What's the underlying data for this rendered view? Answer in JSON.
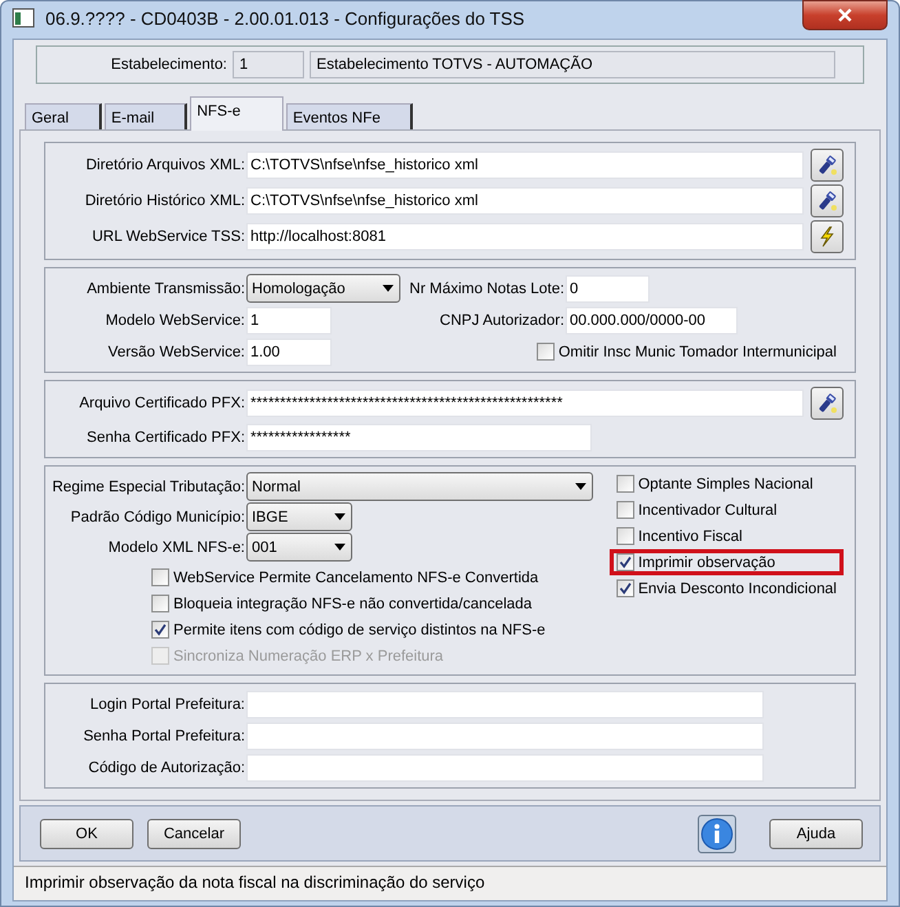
{
  "window": {
    "title": "06.9.???? - CD0403B - 2.00.01.013 - Configurações do TSS"
  },
  "establishment": {
    "label": "Estabelecimento:",
    "code": "1",
    "name": "Estabelecimento TOTVS - AUTOMAÇÃO"
  },
  "tabs": [
    {
      "label": "Geral",
      "selected": false
    },
    {
      "label": "E-mail",
      "selected": false
    },
    {
      "label": "NFS-e",
      "selected": true
    },
    {
      "label": "Eventos NFe",
      "selected": false
    }
  ],
  "directories": [
    {
      "label": "Diretório Arquivos XML:",
      "value": "C:\\TOTVS\\nfse\\nfse_historico xml",
      "kind": "flashlight"
    },
    {
      "label": "Diretório Histórico XML:",
      "value": "C:\\TOTVS\\nfse\\nfse_historico xml",
      "kind": "flashlight"
    },
    {
      "label": "URL WebService TSS:",
      "value": "http://localhost:8081",
      "kind": "lightning"
    }
  ],
  "transmission": {
    "environment": {
      "label": "Ambiente Transmissão:",
      "value": "Homologação"
    },
    "model": {
      "label": "Modelo WebService:",
      "value": "1"
    },
    "version": {
      "label": "Versão WebService:",
      "value": "1.00"
    },
    "max_notes": {
      "label": "Nr Máximo Notas Lote:",
      "value": "0"
    },
    "cnpj": {
      "label": "CNPJ Autorizador:",
      "value": "00.000.000/0000-00"
    },
    "omit": {
      "label": "Omitir Insc Munic Tomador Intermunicipal",
      "checked": false
    }
  },
  "certificate": [
    {
      "label": "Arquivo Certificado PFX:",
      "value": "*****************************************************",
      "kind": "flashlight"
    },
    {
      "label": "Senha Certificado PFX:",
      "value": "*****************",
      "kind": "short"
    }
  ],
  "tax": {
    "selects": [
      {
        "label": "Regime Especial Tributação:",
        "value": "Normal",
        "kind": "wide"
      },
      {
        "label": "Padrão Código Município:",
        "value": "IBGE",
        "kind": "narrow"
      },
      {
        "label": "Modelo XML NFS-e:",
        "value": "001",
        "kind": "narrow"
      }
    ],
    "options": [
      {
        "label": "WebService Permite Cancelamento NFS-e Convertida",
        "checked": false,
        "disabled": false
      },
      {
        "label": "Bloqueia integração NFS-e não convertida/cancelada",
        "checked": false,
        "disabled": false
      },
      {
        "label": "Permite itens com código de serviço distintos na NFS-e",
        "checked": true,
        "disabled": false
      },
      {
        "label": "Sincroniza Numeração ERP x Prefeitura",
        "checked": false,
        "disabled": true
      }
    ],
    "flags": [
      {
        "label": "Optante Simples Nacional",
        "checked": false,
        "highlighted": false
      },
      {
        "label": "Incentivador Cultural",
        "checked": false,
        "highlighted": false
      },
      {
        "label": "Incentivo Fiscal",
        "checked": false,
        "highlighted": false
      },
      {
        "label": "Imprimir observação",
        "checked": true,
        "highlighted": true
      },
      {
        "label": "Envia Desconto Incondicional",
        "checked": true,
        "highlighted": false
      }
    ]
  },
  "portal": [
    {
      "label": "Login Portal Prefeitura:",
      "kind": "long"
    },
    {
      "label": "Senha Portal Prefeitura:",
      "kind": "long"
    },
    {
      "label": "Código de Autorização:",
      "kind": "long"
    }
  ],
  "buttons": {
    "left": [
      "OK",
      "Cancelar"
    ],
    "right": [
      "Ajuda"
    ]
  },
  "status_bar": "Imprimir observação da nota fiscal na discriminação do serviço"
}
